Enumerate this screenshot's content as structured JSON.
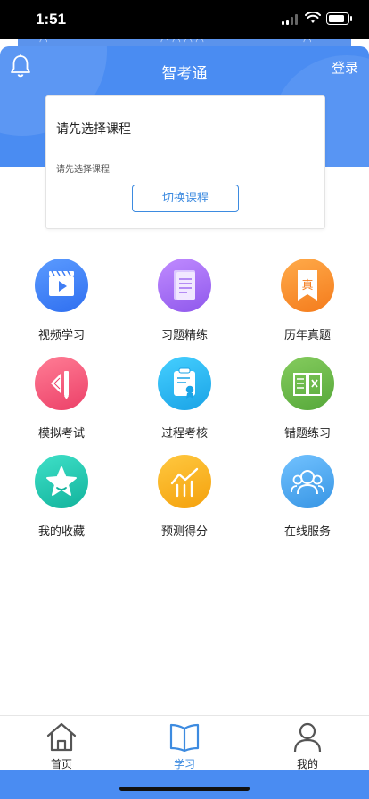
{
  "status_bar": {
    "time": "1:51"
  },
  "header": {
    "title": "智考通",
    "login_label": "登录"
  },
  "course_card": {
    "heading": "请先选择课程",
    "subtext": "请先选择课程",
    "switch_button": "切换课程"
  },
  "features": [
    {
      "label": "视频学习",
      "icon": "video-play-icon",
      "color": "#3f7df4"
    },
    {
      "label": "习题精练",
      "icon": "document-icon",
      "color": "#a06cf0"
    },
    {
      "label": "历年真题",
      "icon": "bookmark-icon",
      "color": "#fb8f2f"
    },
    {
      "label": "模拟考试",
      "icon": "ruler-pencil-icon",
      "color": "#f25c7c"
    },
    {
      "label": "过程考核",
      "icon": "clipboard-badge-icon",
      "color": "#2bb8ef"
    },
    {
      "label": "错题练习",
      "icon": "open-book-icon",
      "color": "#6cba4a"
    },
    {
      "label": "我的收藏",
      "icon": "star-icon",
      "color": "#22c7b0"
    },
    {
      "label": "预测得分",
      "icon": "trend-chart-icon",
      "color": "#f9b51a"
    },
    {
      "label": "在线服务",
      "icon": "people-icon",
      "color": "#4aa8ec"
    }
  ],
  "tabbar": {
    "tabs": [
      {
        "label": "首页",
        "icon": "home-icon",
        "active": false
      },
      {
        "label": "学习",
        "icon": "book-icon",
        "active": true
      },
      {
        "label": "我的",
        "icon": "person-icon",
        "active": false
      }
    ],
    "active_color": "#3d8be0"
  }
}
